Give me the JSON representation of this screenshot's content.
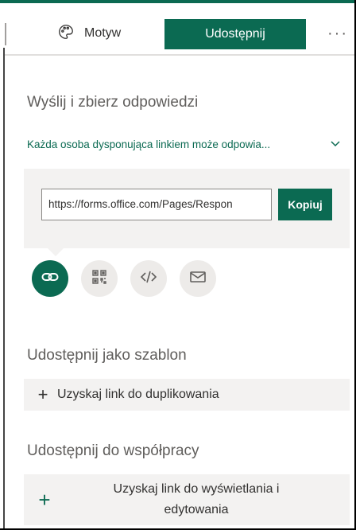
{
  "header": {
    "theme_label": "Motyw",
    "share_label": "Udostępnij",
    "more_label": "···"
  },
  "send_section": {
    "title": "Wyślij i zbierz odpowiedzi",
    "scope_label": "Każda osoba dysponująca linkiem może odpowia...",
    "link_value": "https://forms.office.com/Pages/Respon",
    "copy_label": "Kopiuj"
  },
  "share_icons": [
    {
      "name": "link-icon",
      "active": true
    },
    {
      "name": "qr-code-icon",
      "active": false
    },
    {
      "name": "embed-code-icon",
      "active": false
    },
    {
      "name": "mail-icon",
      "active": false
    }
  ],
  "template_section": {
    "title": "Udostępnij jako szablon",
    "action_label": "Uzyskaj link do duplikowania"
  },
  "collab_section": {
    "title": "Udostępnij do współpracy",
    "action_label_line1": "Uzyskaj link do wyświetlania i",
    "action_label_line2": "edytowania"
  },
  "colors": {
    "accent": "#0b6a52"
  }
}
